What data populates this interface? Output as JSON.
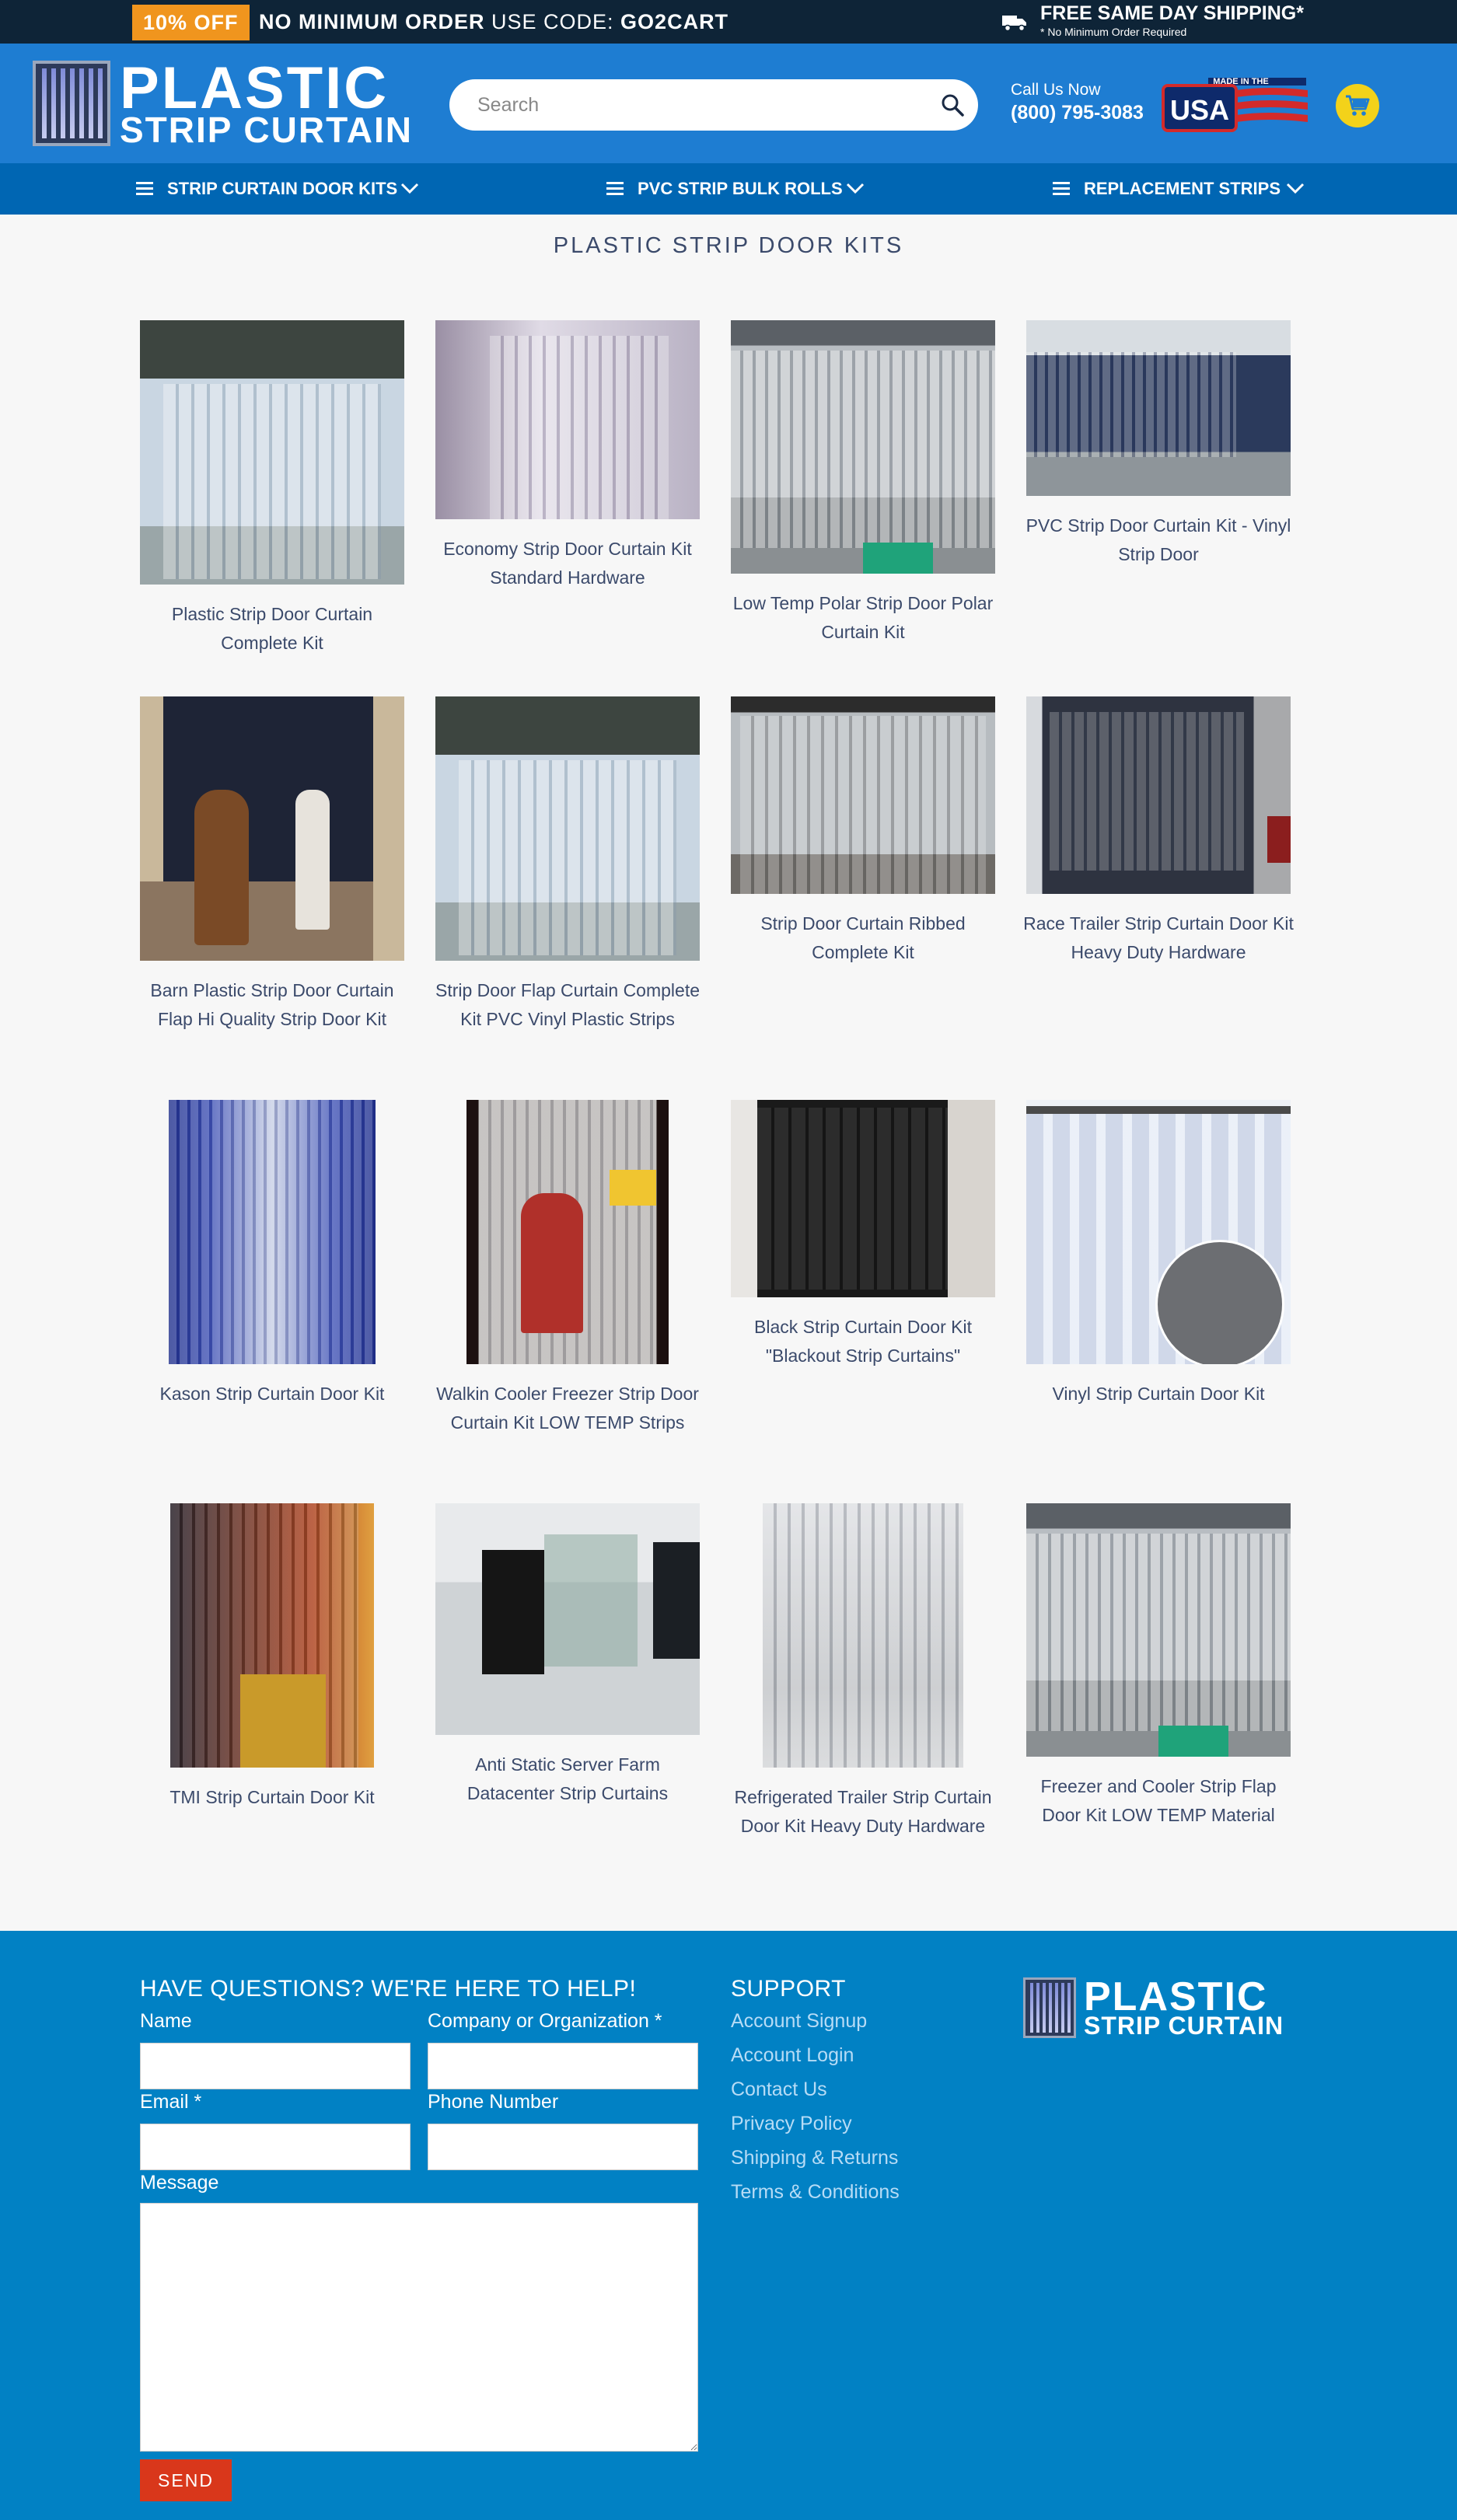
{
  "promo": {
    "badge": "10% OFF",
    "text_bold": "NO MINIMUM ORDER",
    "text_regular": "USE CODE:",
    "code": "GO2CART",
    "shipping_title": "FREE SAME DAY SHIPPING*",
    "shipping_sub": "* No Minimum Order Required"
  },
  "header": {
    "logo_line1": "PLASTIC",
    "logo_line2": "STRIP CURTAIN",
    "search_placeholder": "Search",
    "call_label": "Call Us Now",
    "call_number": "(800) 795-3083",
    "usa_badge_top": "MADE IN THE",
    "usa_badge_main": "USA"
  },
  "nav": {
    "items": [
      {
        "label": "STRIP CURTAIN DOOR KITS"
      },
      {
        "label": "PVC STRIP BULK ROLLS"
      },
      {
        "label": "REPLACEMENT STRIPS"
      }
    ]
  },
  "page": {
    "title": "PLASTIC STRIP DOOR KITS"
  },
  "products": [
    {
      "name": "Plastic Strip Door Curtain Complete Kit"
    },
    {
      "name": "Economy Strip Door Curtain Kit Standard Hardware"
    },
    {
      "name": "Low Temp Polar Strip Door Polar Curtain Kit"
    },
    {
      "name": "PVC Strip Door Curtain Kit - Vinyl Strip Door"
    },
    {
      "name": "Barn Plastic Strip Door Curtain Flap Hi Quality Strip Door Kit"
    },
    {
      "name": "Strip Door Flap Curtain Complete Kit PVC Vinyl Plastic Strips"
    },
    {
      "name": "Strip Door Curtain Ribbed Complete Kit"
    },
    {
      "name": "Race Trailer Strip Curtain Door Kit Heavy Duty Hardware"
    },
    {
      "name": "Kason Strip Curtain Door Kit"
    },
    {
      "name": "Walkin Cooler Freezer Strip Door Curtain Kit LOW TEMP Strips"
    },
    {
      "name": "Black Strip Curtain Door Kit \"Blackout Strip Curtains\""
    },
    {
      "name": "Vinyl Strip Curtain Door Kit"
    },
    {
      "name": "TMI Strip Curtain Door Kit"
    },
    {
      "name": "Anti Static Server Farm Datacenter Strip Curtains"
    },
    {
      "name": "Refrigerated Trailer Strip Curtain Door Kit Heavy Duty Hardware"
    },
    {
      "name": "Freezer and Cooler Strip Flap Door Kit LOW TEMP Material"
    }
  ],
  "footer": {
    "contact_heading": "HAVE QUESTIONS? WE'RE HERE TO HELP!",
    "name_label": "Name",
    "company_label": "Company or Organization *",
    "email_label": "Email *",
    "phone_label": "Phone Number",
    "message_label": "Message",
    "send_label": "SEND",
    "support_heading": "SUPPORT",
    "support_links": [
      {
        "label": "Account Signup"
      },
      {
        "label": "Account Login"
      },
      {
        "label": "Contact Us"
      },
      {
        "label": "Privacy Policy"
      },
      {
        "label": "Shipping & Returns"
      },
      {
        "label": "Terms & Conditions"
      }
    ],
    "logo_line1": "PLASTIC",
    "logo_line2": "STRIP CURTAIN"
  },
  "colors": {
    "promo_bg": "#0e2437",
    "badge": "#f0951e",
    "header_bg": "#1e7dd2",
    "nav_bg": "#0066b3",
    "footer_bg": "#0181c4",
    "send_button": "#d9371b",
    "cart": "#f3d21a"
  }
}
